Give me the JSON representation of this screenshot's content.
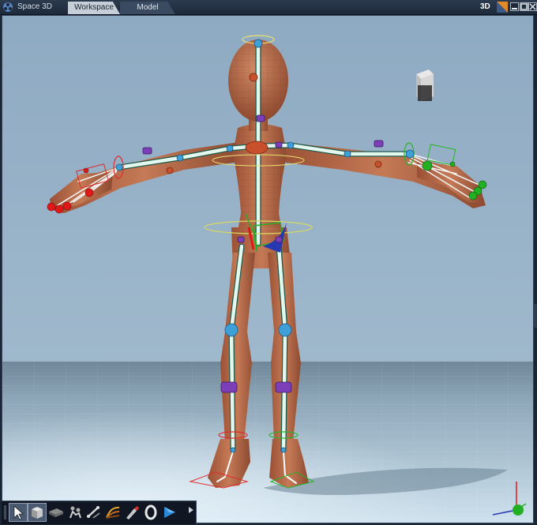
{
  "app": {
    "title": "Space 3D"
  },
  "tabs": [
    {
      "label": "Workspace",
      "active": true
    },
    {
      "label": "Model",
      "active": false
    }
  ],
  "view_mode": "3D",
  "window_controls": [
    "minimize-icon",
    "maximize-icon",
    "close-icon"
  ],
  "toolbar": {
    "tools": [
      {
        "name": "select-arrow-icon",
        "active": true
      },
      {
        "name": "cube-icon",
        "active": true
      },
      {
        "name": "plane-icon",
        "active": false
      },
      {
        "name": "skeleton-icon",
        "active": false
      },
      {
        "name": "bones-icon",
        "active": false
      },
      {
        "name": "wave-icon",
        "active": false
      },
      {
        "name": "paint-icon",
        "active": false
      },
      {
        "name": "ring-icon",
        "active": false
      },
      {
        "name": "render-icon",
        "active": false
      }
    ]
  },
  "colors": {
    "sky": "#90acc4",
    "floor": "#b9d2e3",
    "skin": "#b8694a",
    "bone": "#dff3ea",
    "joint": "#3fa0d8",
    "control_purple": "#7c3fb8",
    "control_red": "#e01818",
    "control_green": "#22b022"
  }
}
